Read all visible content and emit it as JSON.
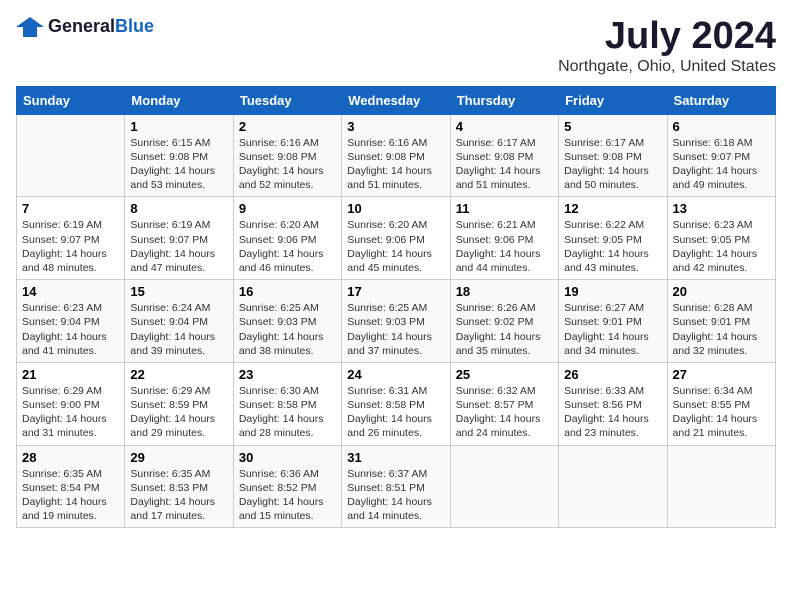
{
  "header": {
    "logo_general": "General",
    "logo_blue": "Blue",
    "month": "July 2024",
    "location": "Northgate, Ohio, United States"
  },
  "days_of_week": [
    "Sunday",
    "Monday",
    "Tuesday",
    "Wednesday",
    "Thursday",
    "Friday",
    "Saturday"
  ],
  "weeks": [
    [
      {
        "day": "",
        "content": ""
      },
      {
        "day": "1",
        "content": "Sunrise: 6:15 AM\nSunset: 9:08 PM\nDaylight: 14 hours\nand 53 minutes."
      },
      {
        "day": "2",
        "content": "Sunrise: 6:16 AM\nSunset: 9:08 PM\nDaylight: 14 hours\nand 52 minutes."
      },
      {
        "day": "3",
        "content": "Sunrise: 6:16 AM\nSunset: 9:08 PM\nDaylight: 14 hours\nand 51 minutes."
      },
      {
        "day": "4",
        "content": "Sunrise: 6:17 AM\nSunset: 9:08 PM\nDaylight: 14 hours\nand 51 minutes."
      },
      {
        "day": "5",
        "content": "Sunrise: 6:17 AM\nSunset: 9:08 PM\nDaylight: 14 hours\nand 50 minutes."
      },
      {
        "day": "6",
        "content": "Sunrise: 6:18 AM\nSunset: 9:07 PM\nDaylight: 14 hours\nand 49 minutes."
      }
    ],
    [
      {
        "day": "7",
        "content": "Sunrise: 6:19 AM\nSunset: 9:07 PM\nDaylight: 14 hours\nand 48 minutes."
      },
      {
        "day": "8",
        "content": "Sunrise: 6:19 AM\nSunset: 9:07 PM\nDaylight: 14 hours\nand 47 minutes."
      },
      {
        "day": "9",
        "content": "Sunrise: 6:20 AM\nSunset: 9:06 PM\nDaylight: 14 hours\nand 46 minutes."
      },
      {
        "day": "10",
        "content": "Sunrise: 6:20 AM\nSunset: 9:06 PM\nDaylight: 14 hours\nand 45 minutes."
      },
      {
        "day": "11",
        "content": "Sunrise: 6:21 AM\nSunset: 9:06 PM\nDaylight: 14 hours\nand 44 minutes."
      },
      {
        "day": "12",
        "content": "Sunrise: 6:22 AM\nSunset: 9:05 PM\nDaylight: 14 hours\nand 43 minutes."
      },
      {
        "day": "13",
        "content": "Sunrise: 6:23 AM\nSunset: 9:05 PM\nDaylight: 14 hours\nand 42 minutes."
      }
    ],
    [
      {
        "day": "14",
        "content": "Sunrise: 6:23 AM\nSunset: 9:04 PM\nDaylight: 14 hours\nand 41 minutes."
      },
      {
        "day": "15",
        "content": "Sunrise: 6:24 AM\nSunset: 9:04 PM\nDaylight: 14 hours\nand 39 minutes."
      },
      {
        "day": "16",
        "content": "Sunrise: 6:25 AM\nSunset: 9:03 PM\nDaylight: 14 hours\nand 38 minutes."
      },
      {
        "day": "17",
        "content": "Sunrise: 6:25 AM\nSunset: 9:03 PM\nDaylight: 14 hours\nand 37 minutes."
      },
      {
        "day": "18",
        "content": "Sunrise: 6:26 AM\nSunset: 9:02 PM\nDaylight: 14 hours\nand 35 minutes."
      },
      {
        "day": "19",
        "content": "Sunrise: 6:27 AM\nSunset: 9:01 PM\nDaylight: 14 hours\nand 34 minutes."
      },
      {
        "day": "20",
        "content": "Sunrise: 6:28 AM\nSunset: 9:01 PM\nDaylight: 14 hours\nand 32 minutes."
      }
    ],
    [
      {
        "day": "21",
        "content": "Sunrise: 6:29 AM\nSunset: 9:00 PM\nDaylight: 14 hours\nand 31 minutes."
      },
      {
        "day": "22",
        "content": "Sunrise: 6:29 AM\nSunset: 8:59 PM\nDaylight: 14 hours\nand 29 minutes."
      },
      {
        "day": "23",
        "content": "Sunrise: 6:30 AM\nSunset: 8:58 PM\nDaylight: 14 hours\nand 28 minutes."
      },
      {
        "day": "24",
        "content": "Sunrise: 6:31 AM\nSunset: 8:58 PM\nDaylight: 14 hours\nand 26 minutes."
      },
      {
        "day": "25",
        "content": "Sunrise: 6:32 AM\nSunset: 8:57 PM\nDaylight: 14 hours\nand 24 minutes."
      },
      {
        "day": "26",
        "content": "Sunrise: 6:33 AM\nSunset: 8:56 PM\nDaylight: 14 hours\nand 23 minutes."
      },
      {
        "day": "27",
        "content": "Sunrise: 6:34 AM\nSunset: 8:55 PM\nDaylight: 14 hours\nand 21 minutes."
      }
    ],
    [
      {
        "day": "28",
        "content": "Sunrise: 6:35 AM\nSunset: 8:54 PM\nDaylight: 14 hours\nand 19 minutes."
      },
      {
        "day": "29",
        "content": "Sunrise: 6:35 AM\nSunset: 8:53 PM\nDaylight: 14 hours\nand 17 minutes."
      },
      {
        "day": "30",
        "content": "Sunrise: 6:36 AM\nSunset: 8:52 PM\nDaylight: 14 hours\nand 15 minutes."
      },
      {
        "day": "31",
        "content": "Sunrise: 6:37 AM\nSunset: 8:51 PM\nDaylight: 14 hours\nand 14 minutes."
      },
      {
        "day": "",
        "content": ""
      },
      {
        "day": "",
        "content": ""
      },
      {
        "day": "",
        "content": ""
      }
    ]
  ]
}
